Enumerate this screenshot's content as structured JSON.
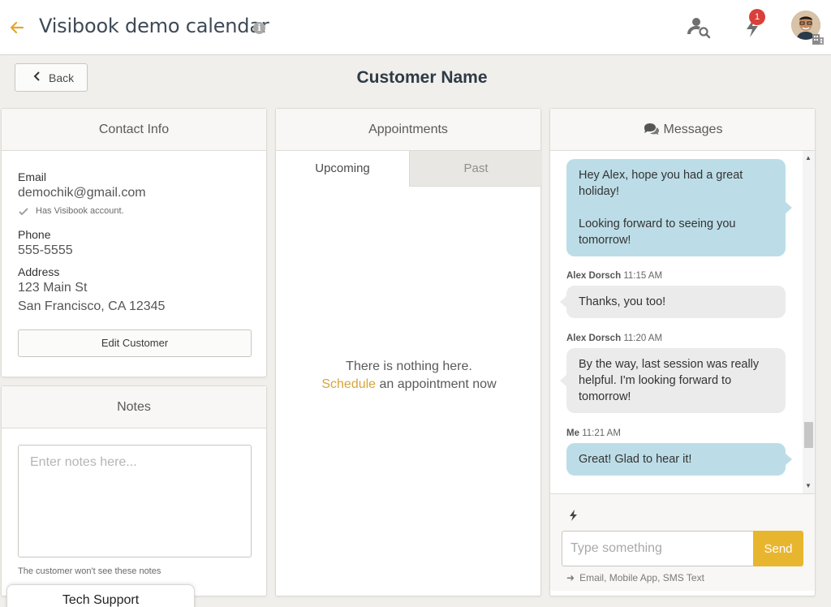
{
  "topbar": {
    "title": "Visibook demo calendar",
    "notification_count": "1",
    "icons": [
      "back-arrow-icon",
      "info-icon",
      "user-search-icon",
      "lightning-icon",
      "avatar",
      "building-icon"
    ]
  },
  "subheader": {
    "back_label": "Back",
    "page_title": "Customer Name"
  },
  "contact": {
    "header": "Contact Info",
    "email_label": "Email",
    "email_value": "demochik@gmail.com",
    "email_note": "Has Visibook account.",
    "phone_label": "Phone",
    "phone_value": "555-5555",
    "address_label": "Address",
    "address_line1": "123 Main St",
    "address_line2": "San Francisco, CA 12345",
    "edit_button": "Edit Customer"
  },
  "notes": {
    "header": "Notes",
    "placeholder": "Enter notes here...",
    "footnote": "The customer won't see these notes"
  },
  "appointments": {
    "header": "Appointments",
    "tabs": [
      {
        "label": "Upcoming",
        "active": true
      },
      {
        "label": "Past",
        "active": false
      }
    ],
    "empty_line1": "There is nothing here.",
    "schedule_link": "Schedule",
    "empty_line2_rest": " an appointment now"
  },
  "messages": {
    "header": "Messages",
    "items": [
      {
        "sender": "me",
        "text_p1": "Hey Alex, hope you had a great holiday!",
        "text_p2": "Looking forward to seeing you tomorrow!"
      },
      {
        "sender": "them",
        "name": "Alex Dorsch",
        "time": "11:15 AM",
        "text": "Thanks, you too!"
      },
      {
        "sender": "them",
        "name": "Alex Dorsch",
        "time": "11:20 AM",
        "text": "By the way, last session was really helpful. I'm looking forward to tomorrow!"
      },
      {
        "sender": "me",
        "name": "Me",
        "time": "11:21 AM",
        "text": "Great! Glad to hear it!"
      }
    ],
    "input_placeholder": "Type something",
    "send_label": "Send",
    "channels": "Email, Mobile App, SMS Text"
  },
  "tech_support": {
    "label": "Tech Support"
  },
  "colors": {
    "accent": "#e8b52f",
    "link": "#d6a53a",
    "bubble_me": "#bcdde7",
    "bubble_them": "#ebebeb",
    "badge": "#d9403a"
  }
}
